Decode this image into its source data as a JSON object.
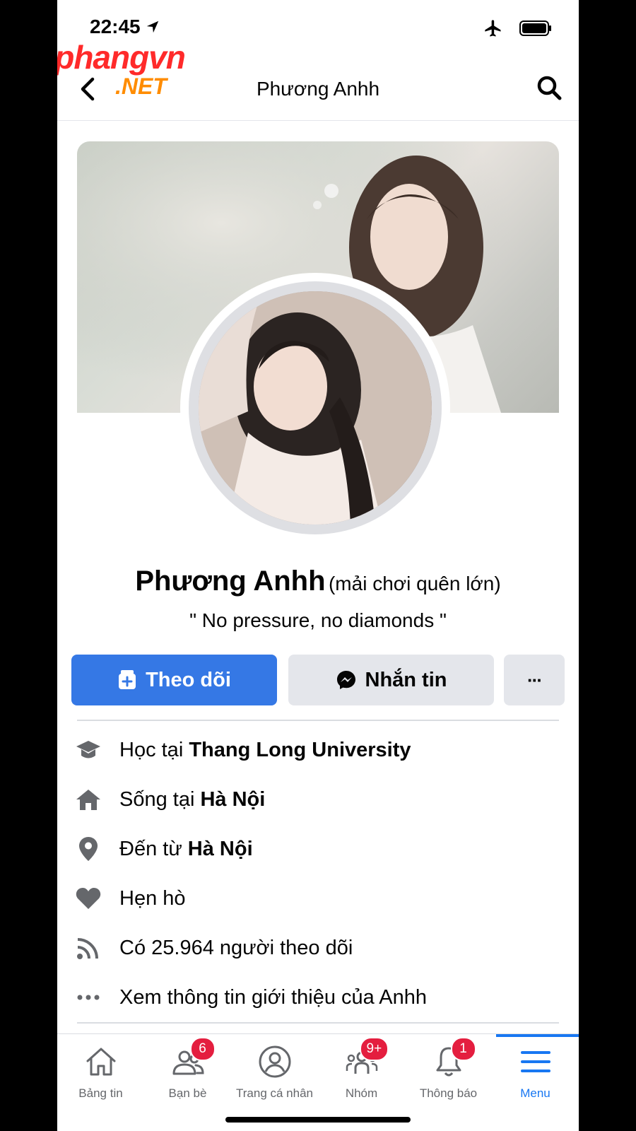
{
  "status_bar": {
    "time": "22:45"
  },
  "watermark": {
    "main_red": "Rp",
    "main_rest": "hangvn",
    "suffix": ".NET"
  },
  "header": {
    "title": "Phương Anhh"
  },
  "profile": {
    "name": "Phương Anhh",
    "alternate_name": "(mải chơi quên lớn)",
    "bio": "\" No pressure, no diamonds \""
  },
  "actions": {
    "follow_label": "Theo dõi",
    "message_label": "Nhắn tin",
    "more_label": "···"
  },
  "intro": {
    "study_prefix": "Học tại ",
    "study_value": "Thang Long University",
    "live_prefix": "Sống tại ",
    "live_value": "Hà Nội",
    "from_prefix": "Đến từ ",
    "from_value": "Hà Nội",
    "relationship": "Hẹn hò",
    "followers": "Có 25.964 người theo dõi",
    "see_about": "Xem thông tin giới thiệu của Anhh"
  },
  "bottom_nav": {
    "items": [
      {
        "label": "Bảng tin",
        "icon": "home-icon"
      },
      {
        "label": "Bạn bè",
        "icon": "friends-icon",
        "badge": "6"
      },
      {
        "label": "Trang cá nhân",
        "icon": "profile-icon"
      },
      {
        "label": "Nhóm",
        "icon": "groups-icon",
        "badge": "9+"
      },
      {
        "label": "Thông báo",
        "icon": "bell-icon",
        "badge": "1"
      },
      {
        "label": "Menu",
        "icon": "menu-icon",
        "active": true
      }
    ]
  },
  "colors": {
    "primary": "#3578e5",
    "active_nav": "#1877f2",
    "badge": "#e41e3f",
    "secondary_button": "#e4e6eb"
  }
}
